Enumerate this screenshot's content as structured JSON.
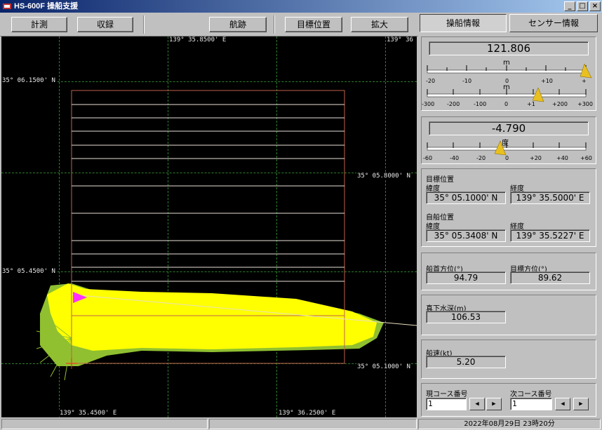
{
  "window": {
    "title": "HS-600F  操船支援",
    "min": "_",
    "max": "□",
    "close": "×"
  },
  "toolbar": {
    "measure": "計測",
    "record": "収録",
    "track": "航跡",
    "target_pos": "目標位置",
    "zoom": "拡大"
  },
  "map": {
    "lon_top_1": "139° 35.8500' E",
    "lon_top_2": "139° 36",
    "lat_1": "35° 06.1500' N",
    "lat_2": "35° 05.8000' N",
    "lat_3": "35° 05.4500' N",
    "lat_4": "35° 05.1000' N",
    "lon_bottom_1": "139° 35.4500' E",
    "lon_bottom_2": "139° 36.2500' E",
    "colors": {
      "route_box": "#c0604c",
      "coverage": "#ffff00",
      "coverage_low": "#90c030",
      "ship": "#ff30ff",
      "grid": "#2e7d2e"
    }
  },
  "tabs": {
    "ship_info": "操船情報",
    "sensor_info": "センサー情報"
  },
  "panel": {
    "offset_value": "121.806",
    "scale_unit_m": "m",
    "scale1_ticks": [
      "-20",
      "-10",
      "0",
      "+10",
      "+"
    ],
    "scale2_ticks": [
      "-300",
      "-200",
      "-100",
      "0",
      "+1",
      "+200",
      "+300"
    ],
    "angle_value": "-4.790",
    "scale_unit_deg": "度",
    "scale3_ticks": [
      "-60",
      "-40",
      "-20",
      "0",
      "+20",
      "+40",
      "+60"
    ],
    "target_position_label": "目標位置",
    "target_lat_label": "緯度",
    "target_lon_label": "経度",
    "target_lat": "35° 05.1000' N",
    "target_lon": "139° 35.5000' E",
    "own_position_label": "自船位置",
    "own_lat_label": "緯度",
    "own_lon_label": "経度",
    "own_lat": "35° 05.3408' N",
    "own_lon": "139° 35.5227' E",
    "heading_label": "船首方位(°)",
    "heading_value": "94.79",
    "target_bearing_label": "目標方位(°)",
    "target_bearing_value": "89.62",
    "depth_label": "真下水深(m)",
    "depth_value": "106.53",
    "speed_label": "船速(kt)",
    "speed_value": "5.20",
    "current_course_label": "現コース番号",
    "current_course_value": "1",
    "next_course_label": "次コース番号",
    "next_course_value": "1",
    "indicator_color": "#e8c020"
  },
  "status": {
    "datetime": "2022年08月29日 23時20分"
  }
}
